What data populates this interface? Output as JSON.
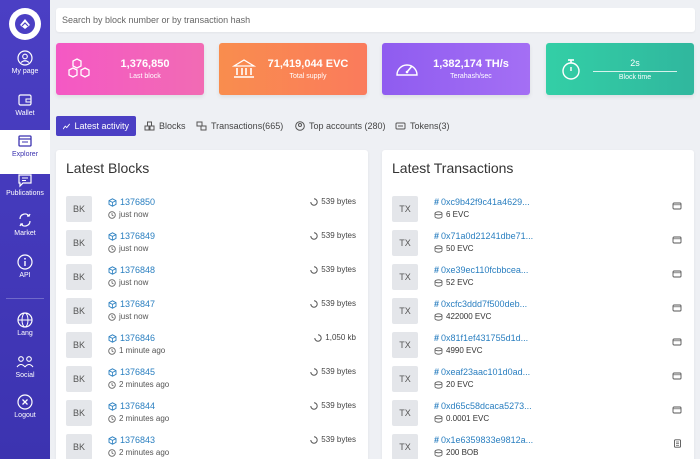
{
  "search": {
    "placeholder": "Search by block number or by transaction hash"
  },
  "sidebar": {
    "items": [
      {
        "label": "My page"
      },
      {
        "label": "Wallet"
      },
      {
        "label": "Explorer"
      },
      {
        "label": "Publications"
      },
      {
        "label": "Market"
      },
      {
        "label": "API"
      },
      {
        "label": "Lang"
      },
      {
        "label": "Social"
      },
      {
        "label": "Logout"
      }
    ]
  },
  "stats": [
    {
      "value": "1,376,850",
      "label": "Last block"
    },
    {
      "value": "71,419,044 EVC",
      "label": "Total supply"
    },
    {
      "value": "1,382,174 TH/s",
      "label": "Terahash/sec"
    },
    {
      "value": "2s",
      "label": "Block time"
    }
  ],
  "tabs": [
    {
      "label": "Latest activity"
    },
    {
      "label": "Blocks"
    },
    {
      "label": "Transactions(665)"
    },
    {
      "label": "Top accounts (280)"
    },
    {
      "label": "Tokens(3)"
    }
  ],
  "blocks": {
    "title": "Latest Blocks",
    "badge": "BK",
    "rows": [
      {
        "number": "1376850",
        "time": "just now",
        "size": "539 bytes"
      },
      {
        "number": "1376849",
        "time": "just now",
        "size": "539 bytes"
      },
      {
        "number": "1376848",
        "time": "just now",
        "size": "539 bytes"
      },
      {
        "number": "1376847",
        "time": "just now",
        "size": "539 bytes"
      },
      {
        "number": "1376846",
        "time": "1 minute ago",
        "size": "1,050 kb"
      },
      {
        "number": "1376845",
        "time": "2 minutes ago",
        "size": "539 bytes"
      },
      {
        "number": "1376844",
        "time": "2 minutes ago",
        "size": "539 bytes"
      },
      {
        "number": "1376843",
        "time": "2 minutes ago",
        "size": "539 bytes"
      }
    ]
  },
  "transactions": {
    "title": "Latest Transactions",
    "badge": "TX",
    "rows": [
      {
        "hash": "0xc9b42f9c41a4629...",
        "amount": "6 EVC"
      },
      {
        "hash": "0x71a0d21241dbe71...",
        "amount": "50 EVC"
      },
      {
        "hash": "0xe39ec110fcbbcea...",
        "amount": "52 EVC"
      },
      {
        "hash": "0xcfc3ddd7f500deb...",
        "amount": "422000 EVC"
      },
      {
        "hash": "0x81f1ef431755d1d...",
        "amount": "4990 EVC"
      },
      {
        "hash": "0xeaf23aac101d0ad...",
        "amount": "20 EVC"
      },
      {
        "hash": "0xd65c58dcaca5273...",
        "amount": "0.0001 EVC"
      },
      {
        "hash": "0x1e6359833e9812a...",
        "amount": "200 BOB"
      }
    ]
  },
  "colors": {
    "primary": "#4b3fc4",
    "link": "#2a7fc0"
  }
}
